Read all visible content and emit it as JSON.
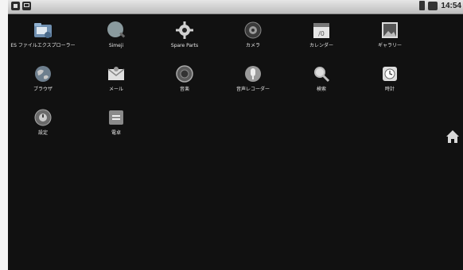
{
  "status_bar": {
    "left_icons": [
      "sd-card-icon",
      "usb-icon"
    ],
    "right_icons": [
      "battery-icon",
      "signal-icon"
    ],
    "time": "14:54"
  },
  "apps": [
    {
      "label": "ES ファイルエクスプローラー",
      "icon": "folder-icon"
    },
    {
      "label": "Simeji",
      "icon": "simeji-icon"
    },
    {
      "label": "Spare Parts",
      "icon": "gear-icon"
    },
    {
      "label": "カメラ",
      "icon": "camera-icon"
    },
    {
      "label": "カレンダー",
      "icon": "calendar-icon"
    },
    {
      "label": "ギャラリー",
      "icon": "gallery-icon"
    },
    {
      "label": "ブラウザ",
      "icon": "globe-icon"
    },
    {
      "label": "メール",
      "icon": "mail-icon"
    },
    {
      "label": "音楽",
      "icon": "music-icon"
    },
    {
      "label": "音声レコーダー",
      "icon": "microphone-icon"
    },
    {
      "label": "検索",
      "icon": "magnifier-icon"
    },
    {
      "label": "時計",
      "icon": "clock-icon"
    },
    {
      "label": "設定",
      "icon": "settings-icon"
    },
    {
      "label": "電卓",
      "icon": "calculator-icon"
    }
  ],
  "home_button": {
    "icon": "home-icon"
  }
}
